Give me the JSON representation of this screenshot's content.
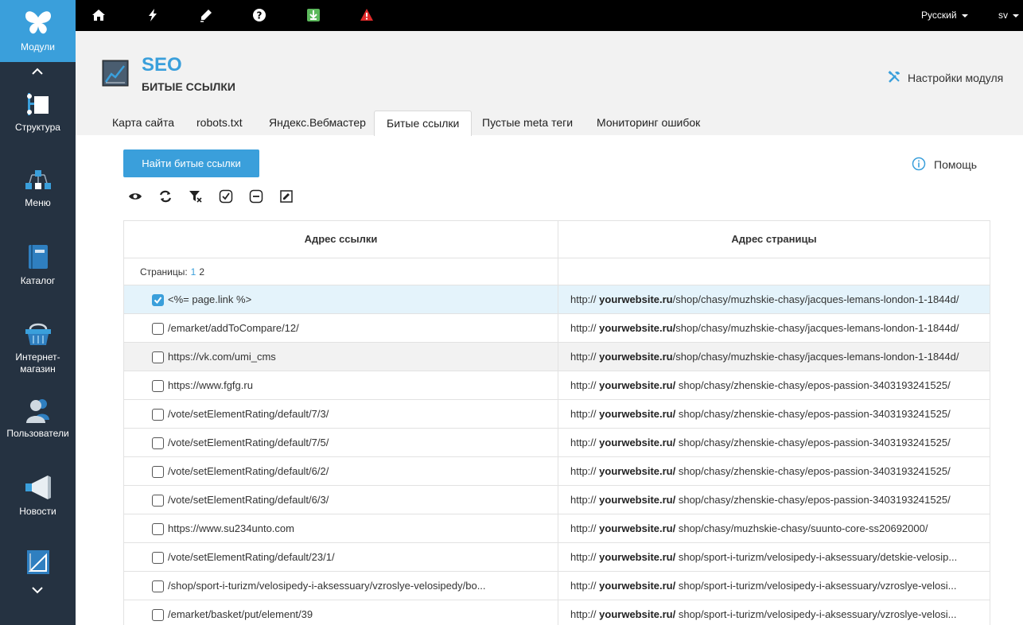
{
  "sidebar": {
    "items": [
      {
        "label": "Модули",
        "icon": "butterfly-icon"
      },
      {
        "label": "Структура",
        "icon": "structure-icon"
      },
      {
        "label": "Меню",
        "icon": "menu-icon"
      },
      {
        "label": "Каталог",
        "icon": "catalog-icon"
      },
      {
        "label": "Интернет-магазин",
        "label_line1": "Интернет-",
        "label_line2": "магазин",
        "icon": "basket-icon"
      },
      {
        "label": "Пользователи",
        "icon": "users-icon"
      },
      {
        "label": "Новости",
        "icon": "megaphone-icon"
      },
      {
        "label": "",
        "icon": "ruler-icon"
      }
    ]
  },
  "topbar": {
    "icons": [
      "home-icon",
      "lightning-icon",
      "pen-icon",
      "question-icon",
      "download-icon",
      "warning-icon"
    ],
    "language": "Русский",
    "user": "sv",
    "colors": {
      "download": "#5cb85c",
      "warning": "#e02a2a"
    }
  },
  "header": {
    "title": "SEO",
    "subtitle": "БИТЫЕ ССЫЛКИ",
    "settings_label": "Настройки модуля"
  },
  "tabs": [
    {
      "label": "Карта сайта",
      "active": false
    },
    {
      "label": "robots.txt",
      "active": false
    },
    {
      "label": "Яндекс.Вебмастер",
      "active": false
    },
    {
      "label": "Битые ссылки",
      "active": true
    },
    {
      "label": "Пустые meta теги",
      "active": false
    },
    {
      "label": "Мониторинг ошибок",
      "active": false
    }
  ],
  "main": {
    "find_button": "Найти битые ссылки",
    "help_label": "Помощь",
    "toolbar_icons": [
      "eye-icon",
      "refresh-icon",
      "clear-filter-icon",
      "check-circle-icon",
      "minus-circle-icon",
      "edit-icon"
    ]
  },
  "table": {
    "columns": [
      "Адрес ссылки",
      "Адрес страницы"
    ],
    "pages_label": "Страницы:",
    "pages": [
      "1",
      "2"
    ],
    "rows": [
      {
        "link": "<%= page.link %>",
        "page_prefix": "http://",
        "page_domain": "yourwebsite.ru",
        "page_path": "/shop/chasy/muzhskie-chasy/jacques-lemans-london-1-1844d/",
        "checked": true
      },
      {
        "link": "/emarket/addToCompare/12/",
        "page_prefix": "http://",
        "page_domain": "yourwebsite.ru/",
        "page_path": "shop/chasy/muzhskie-chasy/jacques-lemans-london-1-1844d/",
        "checked": false
      },
      {
        "link": "https://vk.com/umi_cms",
        "page_prefix": "http://",
        "page_domain": "yourwebsite.ru",
        "page_path": "/shop/chasy/muzhskie-chasy/jacques-lemans-london-1-1844d/",
        "checked": false
      },
      {
        "link": "https://www.fgfg.ru",
        "page_prefix": "http://",
        "page_domain": "yourwebsite.ru/",
        "page_path": " shop/chasy/zhenskie-chasy/epos-passion-3403193241525/",
        "checked": false
      },
      {
        "link": "/vote/setElementRating/default/7/3/",
        "page_prefix": "http://",
        "page_domain": "yourwebsite.ru/",
        "page_path": " shop/chasy/zhenskie-chasy/epos-passion-3403193241525/",
        "checked": false
      },
      {
        "link": "/vote/setElementRating/default/7/5/",
        "page_prefix": "http://",
        "page_domain": "yourwebsite.ru/",
        "page_path": " shop/chasy/zhenskie-chasy/epos-passion-3403193241525/",
        "checked": false
      },
      {
        "link": "/vote/setElementRating/default/6/2/",
        "page_prefix": "http://",
        "page_domain": "yourwebsite.ru/",
        "page_path": " shop/chasy/zhenskie-chasy/epos-passion-3403193241525/",
        "checked": false
      },
      {
        "link": "/vote/setElementRating/default/6/3/",
        "page_prefix": "http://",
        "page_domain": "yourwebsite.ru/",
        "page_path": " shop/chasy/zhenskie-chasy/epos-passion-3403193241525/",
        "checked": false
      },
      {
        "link": "https://www.su234unto.com",
        "page_prefix": "http://",
        "page_domain": "yourwebsite.ru/",
        "page_path": " shop/chasy/muzhskie-chasy/suunto-core-ss20692000/",
        "checked": false
      },
      {
        "link": "/vote/setElementRating/default/23/1/",
        "page_prefix": "http://",
        "page_domain": "yourwebsite.ru/",
        "page_path": " shop/sport-i-turizm/velosipedy-i-aksessuary/detskie-velosip...",
        "checked": false
      },
      {
        "link": "/shop/sport-i-turizm/velosipedy-i-aksessuary/vzroslye-velosipedy/bo...",
        "page_prefix": "http://",
        "page_domain": "yourwebsite.ru/",
        "page_path": " shop/sport-i-turizm/velosipedy-i-aksessuary/vzroslye-velosi...",
        "checked": false
      },
      {
        "link": "/emarket/basket/put/element/39",
        "page_prefix": "http://",
        "page_domain": "yourwebsite.ru/",
        "page_path": " shop/sport-i-turizm/velosipedy-i-aksessuary/vzroslye-velosi...",
        "checked": false
      }
    ]
  }
}
